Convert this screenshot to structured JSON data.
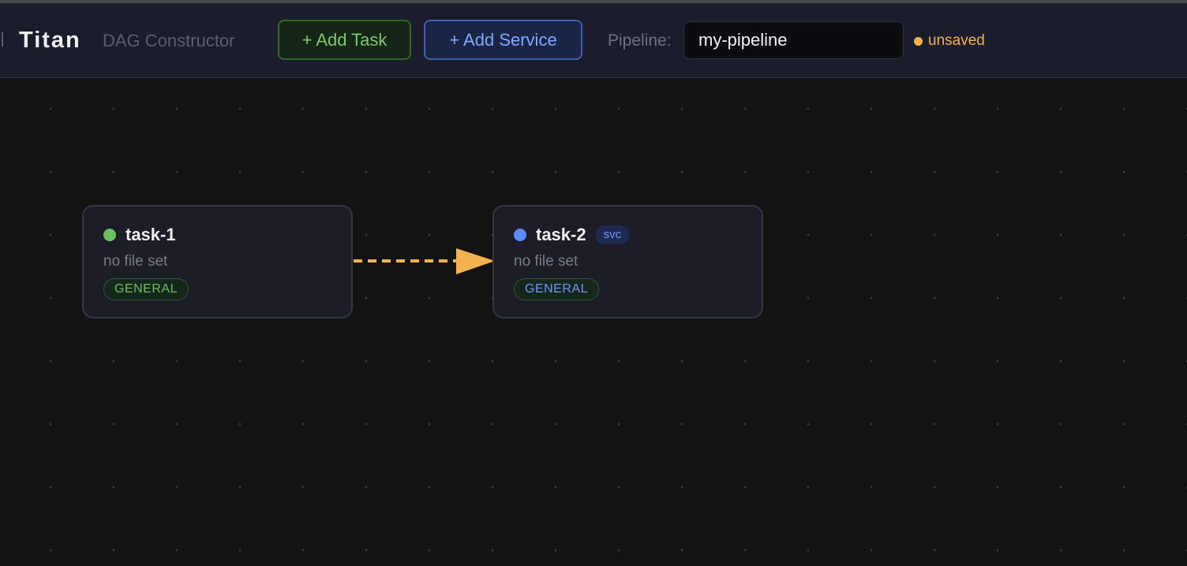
{
  "header": {
    "brand": "Titan",
    "subtitle": "DAG Constructor",
    "add_task_label": "+ Add Task",
    "add_service_label": "+ Add Service",
    "pipeline_label": "Pipeline:",
    "pipeline_value": "my-pipeline",
    "status_text": "unsaved"
  },
  "nodes": [
    {
      "name": "task-1",
      "file": "no file set",
      "tag": "GENERAL",
      "status_color": "#6cc060"
    },
    {
      "name": "task-2",
      "badge": "svc",
      "file": "no file set",
      "tag": "GENERAL",
      "status_color": "#5b8cff"
    }
  ],
  "edges": [
    {
      "from": "task-1",
      "to": "task-2",
      "style": "dashed",
      "color": "#f3b24e"
    }
  ],
  "colors": {
    "accent_unsaved": "#f3b24e",
    "task_green": "#6cc060",
    "service_blue": "#5b8cff"
  }
}
